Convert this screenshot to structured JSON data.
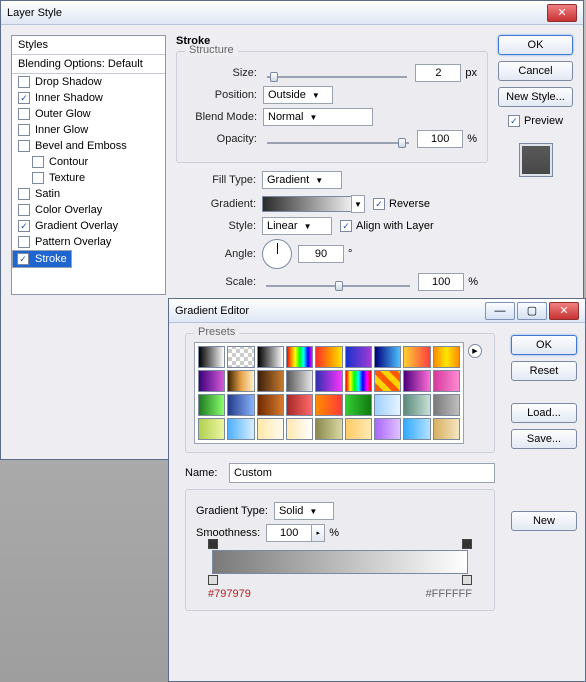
{
  "layerStyle": {
    "windowTitle": "Layer Style",
    "stylesHeader": "Styles",
    "blendingDefault": "Blending Options: Default",
    "styles": [
      {
        "label": "Drop Shadow",
        "checked": false
      },
      {
        "label": "Inner Shadow",
        "checked": true
      },
      {
        "label": "Outer Glow",
        "checked": false
      },
      {
        "label": "Inner Glow",
        "checked": false
      },
      {
        "label": "Bevel and Emboss",
        "checked": false
      },
      {
        "label": "Contour",
        "checked": false,
        "sub": true
      },
      {
        "label": "Texture",
        "checked": false,
        "sub": true
      },
      {
        "label": "Satin",
        "checked": false
      },
      {
        "label": "Color Overlay",
        "checked": false
      },
      {
        "label": "Gradient Overlay",
        "checked": true
      },
      {
        "label": "Pattern Overlay",
        "checked": false
      },
      {
        "label": "Stroke",
        "checked": true,
        "selected": true
      }
    ],
    "stroke": {
      "header": "Stroke",
      "structure": "Structure",
      "sizeLabel": "Size:",
      "sizeValue": "2",
      "pxUnit": "px",
      "positionLabel": "Position:",
      "positionValue": "Outside",
      "blendModeLabel": "Blend Mode:",
      "blendModeValue": "Normal",
      "opacityLabel": "Opacity:",
      "opacityValue": "100",
      "pctUnit": "%",
      "fillTypeLabel": "Fill Type:",
      "fillTypeValue": "Gradient",
      "gradientLabel": "Gradient:",
      "reverseLabel": "Reverse",
      "reverseChecked": true,
      "styleLabel": "Style:",
      "styleValue": "Linear",
      "alignLabel": "Align with Layer",
      "alignChecked": true,
      "angleLabel": "Angle:",
      "angleValue": "90",
      "degUnit": "°",
      "scaleLabel": "Scale:",
      "scaleValue": "100"
    },
    "buttons": {
      "ok": "OK",
      "cancel": "Cancel",
      "newStyle": "New Style...",
      "preview": "Preview",
      "previewChecked": true
    }
  },
  "gradientEditor": {
    "windowTitle": "Gradient Editor",
    "presetsLabel": "Presets",
    "buttons": {
      "ok": "OK",
      "reset": "Reset",
      "load": "Load...",
      "save": "Save...",
      "new": "New"
    },
    "nameLabel": "Name:",
    "nameValue": "Custom",
    "gradientTypeLabel": "Gradient Type:",
    "gradientTypeValue": "Solid",
    "smoothnessLabel": "Smoothness:",
    "smoothnessValue": "100",
    "pctUnit": "%",
    "stops": {
      "leftHex": "#797979",
      "rightHex": "#FFFFFF"
    },
    "swatches": [
      "linear-gradient(90deg,#000,#fff)",
      "repeating-conic-gradient(#ccc 0 25%,#fff 0 50%) 0/8px 8px",
      "linear-gradient(90deg,#000,#fff)",
      "linear-gradient(90deg,#ff0000,#ff8c00,#ffff00,#00ff00,#00ffff,#0000ff,#ff00ff)",
      "linear-gradient(90deg,#ff3030,#ff8a00,#ffe600)",
      "linear-gradient(90deg,#1933cc,#a03ad6)",
      "linear-gradient(90deg,#00007a,#4ec1ff)",
      "linear-gradient(90deg,#ffcf33,#ff3e3e)",
      "linear-gradient(90deg,#ff8c00,#ffe600,#ff8c00)",
      "linear-gradient(90deg,#3b007d,#d65bd6)",
      "linear-gradient(90deg,#3b2200,#e7a24a,#fff1cc)",
      "linear-gradient(90deg,#3b1f0a,#c77a2e)",
      "linear-gradient(90deg,#5a5a5a,#e6e6e6)",
      "linear-gradient(90deg,#3030b0,#ff33ff)",
      "linear-gradient(90deg,#ff0000,#ffff00,#00ff00,#00ffff,#0000ff,#ff00ff,#ff0000)",
      "repeating-linear-gradient(45deg,#ff5a00 0 6px,#ffd200 6px 12px)",
      "linear-gradient(90deg,#4f007d,#ff6ed6)",
      "linear-gradient(90deg,#d53a9d,#ff8ad1)",
      "linear-gradient(90deg,#1f7a1f,#8aff6e)",
      "linear-gradient(90deg,#223a8a,#8ab4ff)",
      "linear-gradient(90deg,#702a00,#d67a2e)",
      "linear-gradient(90deg,#a62828,#ff6a6a)",
      "linear-gradient(90deg,#ff8c00,#ff3a3a)",
      "linear-gradient(90deg,#33cc33,#117a11)",
      "linear-gradient(90deg,#9fd0ff,#e6f3ff)",
      "linear-gradient(90deg,#5a8a7a,#c8e0d5)",
      "linear-gradient(90deg,#7a7a7a,#bfbfbf)",
      "linear-gradient(90deg,#b0d050,#eef5a0)",
      "linear-gradient(90deg,#4eafff,#d9efff)",
      "linear-gradient(90deg,#ffe9a8,#fffaf0)",
      "linear-gradient(90deg,#ffe8b0,#ffffff)",
      "linear-gradient(90deg,#8a8a50,#d8d8a0)",
      "linear-gradient(90deg,#ffcc66,#ffe9b3)",
      "linear-gradient(90deg,#aa66ff,#e0c2ff)",
      "linear-gradient(90deg,#33aaff,#b3e1ff)",
      "linear-gradient(90deg,#d8b060,#f5e5c0)"
    ]
  }
}
